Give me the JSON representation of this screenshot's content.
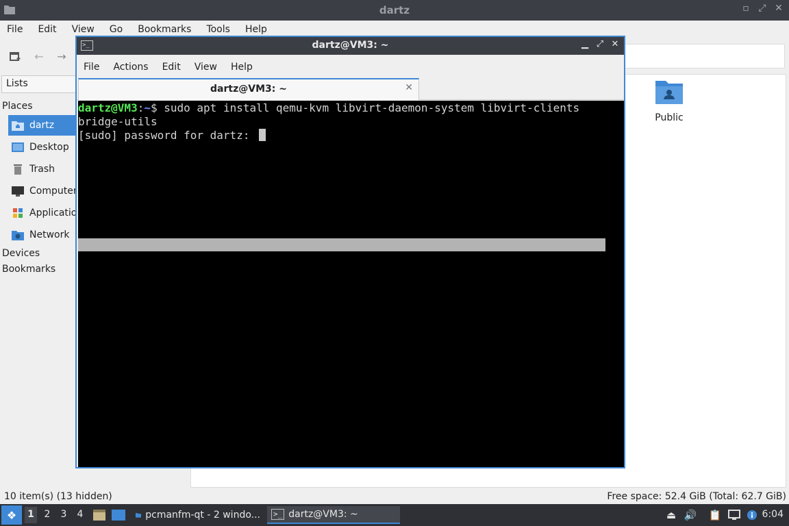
{
  "file_manager": {
    "title": "dartz",
    "menu": [
      "File",
      "Edit",
      "View",
      "Go",
      "Bookmarks",
      "Tools",
      "Help"
    ],
    "sidebar": {
      "selector": "Lists",
      "places_heading": "Places",
      "places": [
        {
          "label": "dartz",
          "icon": "home-folder-icon",
          "active": true
        },
        {
          "label": "Desktop",
          "icon": "desktop-icon"
        },
        {
          "label": "Trash",
          "icon": "trash-icon"
        },
        {
          "label": "Computer",
          "icon": "computer-icon"
        },
        {
          "label": "Applications",
          "icon": "applications-icon"
        },
        {
          "label": "Network",
          "icon": "network-icon"
        }
      ],
      "devices_heading": "Devices",
      "bookmarks_heading": "Bookmarks"
    },
    "items": [
      {
        "label": "Public",
        "icon": "public-folder-icon"
      }
    ],
    "status_left": "10 item(s) (13 hidden)",
    "status_right": "Free space: 52.4 GiB (Total: 62.7 GiB)"
  },
  "terminal": {
    "title": "dartz@VM3: ~",
    "menu": [
      "File",
      "Actions",
      "Edit",
      "View",
      "Help"
    ],
    "tab_label": "dartz@VM3: ~",
    "prompt_user": "dartz@VM3",
    "prompt_sep": ":",
    "prompt_path": "~",
    "prompt_symbol": "$ ",
    "command_line1": "sudo apt install qemu-kvm libvirt-daemon-system libvirt-clients",
    "command_line2": "bridge-utils",
    "password_prompt": "[sudo] password for dartz: "
  },
  "taskbar": {
    "workspaces": [
      "1",
      "2",
      "3",
      "4"
    ],
    "tasks": [
      {
        "label": "pcmanfm-qt - 2 windo...",
        "icon": "folder-icon"
      },
      {
        "label": "dartz@VM3: ~",
        "icon": "terminal-icon",
        "active": true
      }
    ],
    "clock": "6:04"
  },
  "colors": {
    "accent": "#3f88d6",
    "titlebar": "#3b3e44",
    "taskbar": "#2e3035",
    "prompt_user": "#55e655",
    "prompt_path": "#6f8cff"
  }
}
